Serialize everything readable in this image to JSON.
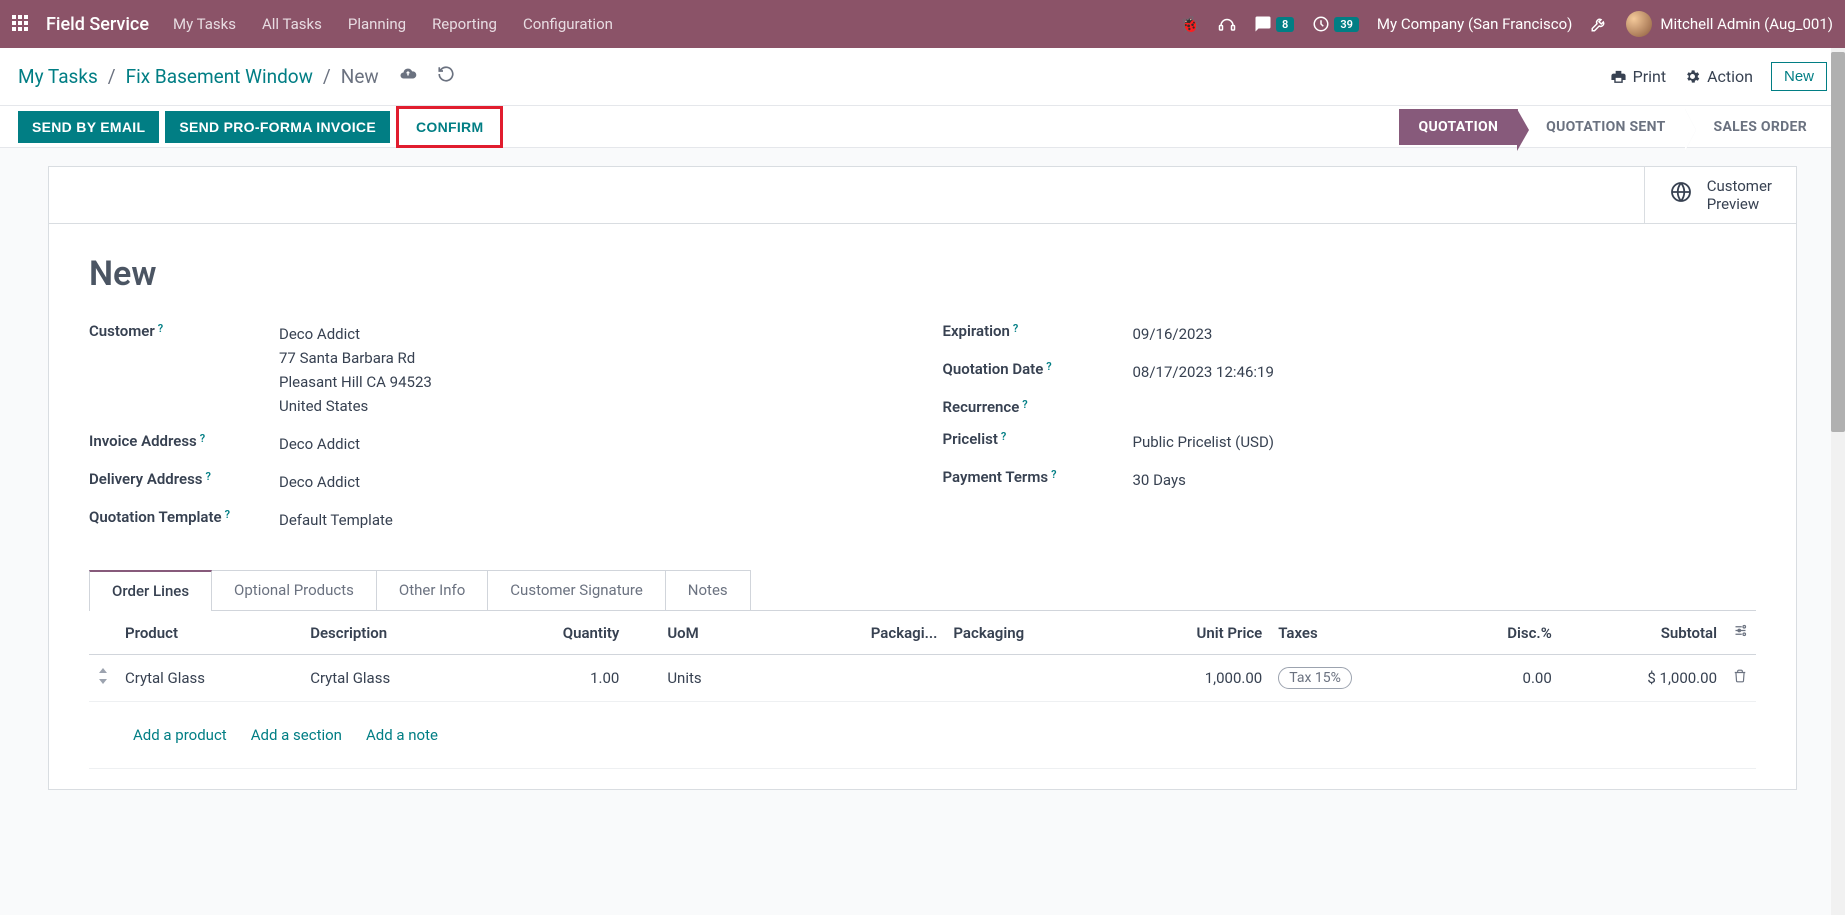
{
  "navbar": {
    "brand": "Field Service",
    "menu": [
      "My Tasks",
      "All Tasks",
      "Planning",
      "Reporting",
      "Configuration"
    ],
    "messages_badge": "8",
    "activities_badge": "39",
    "company": "My Company (San Francisco)",
    "user_name": "Mitchell Admin (Aug_001)"
  },
  "breadcrumb": {
    "items": [
      "My Tasks",
      "Fix Basement Window"
    ],
    "current": "New",
    "print": "Print",
    "action": "Action",
    "new_btn": "New"
  },
  "actions": {
    "send_email": "SEND BY EMAIL",
    "send_proforma": "SEND PRO-FORMA INVOICE",
    "confirm": "CONFIRM"
  },
  "status_steps": [
    {
      "label": "QUOTATION",
      "active": true
    },
    {
      "label": "QUOTATION SENT",
      "active": false
    },
    {
      "label": "SALES ORDER",
      "active": false
    }
  ],
  "customer_preview": {
    "line1": "Customer",
    "line2": "Preview"
  },
  "record": {
    "title": "New",
    "left_fields": {
      "customer_label": "Customer",
      "customer_name": "Deco Addict",
      "customer_addr1": "77 Santa Barbara Rd",
      "customer_addr2": "Pleasant Hill CA 94523",
      "customer_country": "United States",
      "invoice_addr_label": "Invoice Address",
      "invoice_addr": "Deco Addict",
      "delivery_addr_label": "Delivery Address",
      "delivery_addr": "Deco Addict",
      "template_label": "Quotation Template",
      "template": "Default Template"
    },
    "right_fields": {
      "expiration_label": "Expiration",
      "expiration": "09/16/2023",
      "quotation_date_label": "Quotation Date",
      "quotation_date": "08/17/2023 12:46:19",
      "recurrence_label": "Recurrence",
      "recurrence": "",
      "pricelist_label": "Pricelist",
      "pricelist": "Public Pricelist (USD)",
      "payment_terms_label": "Payment Terms",
      "payment_terms": "30 Days"
    }
  },
  "tabs": [
    "Order Lines",
    "Optional Products",
    "Other Info",
    "Customer Signature",
    "Notes"
  ],
  "table": {
    "headers": {
      "product": "Product",
      "description": "Description",
      "quantity": "Quantity",
      "uom": "UoM",
      "packagi": "Packagi...",
      "packaging": "Packaging",
      "unit_price": "Unit Price",
      "taxes": "Taxes",
      "disc": "Disc.%",
      "subtotal": "Subtotal"
    },
    "rows": [
      {
        "product": "Crytal Glass",
        "description": "Crytal Glass",
        "quantity": "1.00",
        "uom": "Units",
        "packagi": "",
        "packaging": "",
        "unit_price": "1,000.00",
        "taxes": "Tax 15%",
        "disc": "0.00",
        "subtotal": "$ 1,000.00"
      }
    ],
    "add_product": "Add a product",
    "add_section": "Add a section",
    "add_note": "Add a note"
  }
}
